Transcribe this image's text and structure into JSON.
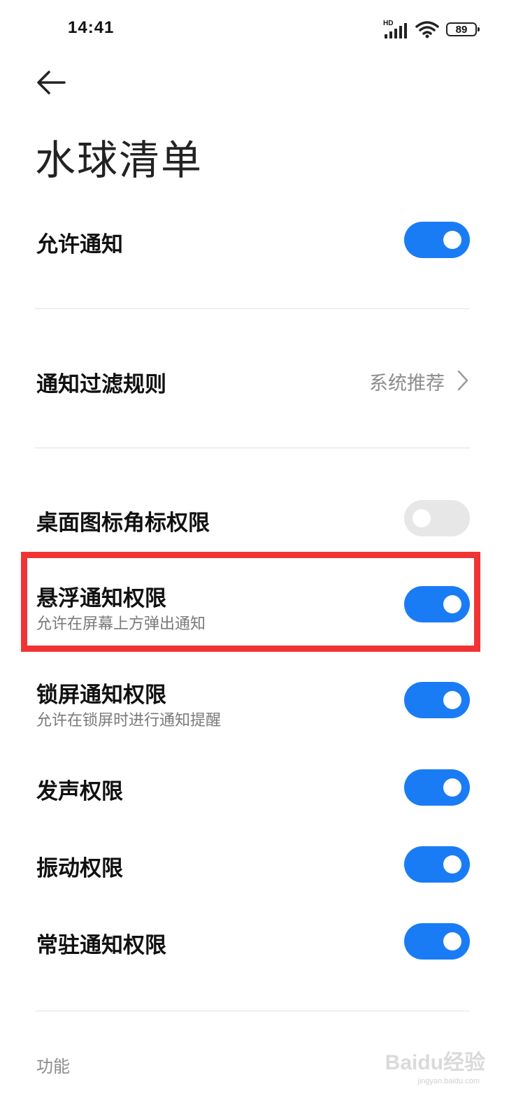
{
  "status_bar": {
    "time": "14:41",
    "network_badge": "HD",
    "battery_level": "89",
    "icons": [
      "signal-icon",
      "wifi-icon",
      "battery-icon"
    ]
  },
  "header": {
    "back_icon": "arrow-left-icon",
    "title": "水球清单"
  },
  "settings": [
    {
      "label": "允许通知",
      "toggle": true
    },
    {
      "label": "通知过滤规则",
      "value": "系统推荐",
      "icon": "chevron-right-icon"
    },
    {
      "label": "桌面图标角标权限",
      "toggle": false
    },
    {
      "label": "悬浮通知权限",
      "subtitle": "允许在屏幕上方弹出通知",
      "toggle": true,
      "highlighted": true
    },
    {
      "label": "锁屏通知权限",
      "subtitle": "允许在锁屏时进行通知提醒",
      "toggle": true
    },
    {
      "label": "发声权限",
      "toggle": true
    },
    {
      "label": "振动权限",
      "toggle": true
    },
    {
      "label": "常驻通知权限",
      "toggle": true
    }
  ],
  "section": {
    "label": "功能"
  },
  "watermark": {
    "text": "Baidu经验",
    "sub": "jingyan.baidu.com"
  },
  "colors": {
    "accent": "#1a7cf5",
    "toggle_off": "#e7e7e7",
    "highlight": "#f03434"
  }
}
